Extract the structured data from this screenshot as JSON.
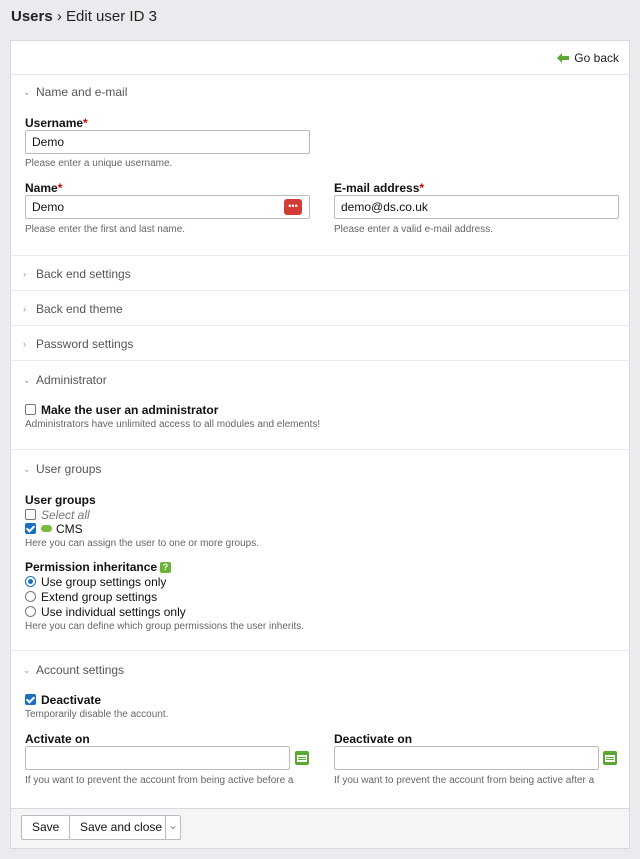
{
  "header": {
    "section": "Users",
    "separator": "›",
    "title": "Edit user ID 3"
  },
  "goback": {
    "label": "Go back",
    "icon": "arrow-left-icon"
  },
  "legends": {
    "name_email": "Name and e-mail",
    "backend_settings": "Back end settings",
    "backend_theme": "Back end theme",
    "password_settings": "Password settings",
    "administrator": "Administrator",
    "user_groups": "User groups",
    "account_settings": "Account settings"
  },
  "fields": {
    "username": {
      "label": "Username",
      "required": "*",
      "value": "Demo",
      "help": "Please enter a unique username."
    },
    "name": {
      "label": "Name",
      "required": "*",
      "value": "Demo",
      "help": "Please enter the first and last name."
    },
    "email": {
      "label": "E-mail address",
      "required": "*",
      "value": "demo@ds.co.uk",
      "help": "Please enter a valid e-mail address."
    }
  },
  "admin": {
    "label": "Make the user an administrator",
    "checked": false,
    "help": "Administrators have unlimited access to all modules and elements!"
  },
  "groups": {
    "label": "User groups",
    "select_all": "Select all",
    "items": [
      {
        "label": "CMS",
        "checked": true
      }
    ],
    "help": "Here you can assign the user to one or more groups."
  },
  "inherit": {
    "label": "Permission inheritance",
    "help_icon": "?",
    "options": [
      {
        "label": "Use group settings only",
        "selected": true
      },
      {
        "label": "Extend group settings",
        "selected": false
      },
      {
        "label": "Use individual settings only",
        "selected": false
      }
    ],
    "help": "Here you can define which group permissions the user inherits."
  },
  "account": {
    "deactivate_label": "Deactivate",
    "deactivate_checked": true,
    "deactivate_help": "Temporarily disable the account.",
    "activate_on": {
      "label": "Activate on",
      "value": "",
      "help": "If you want to prevent the account from being active before a"
    },
    "deactivate_on": {
      "label": "Deactivate on",
      "value": "",
      "help": "If you want to prevent the account from being active after a"
    }
  },
  "footer": {
    "save": "Save",
    "save_close": "Save and close",
    "more": "⌄"
  },
  "colors": {
    "accent": "#1a6fc0",
    "green": "#5aa832",
    "red": "#d23b37"
  }
}
